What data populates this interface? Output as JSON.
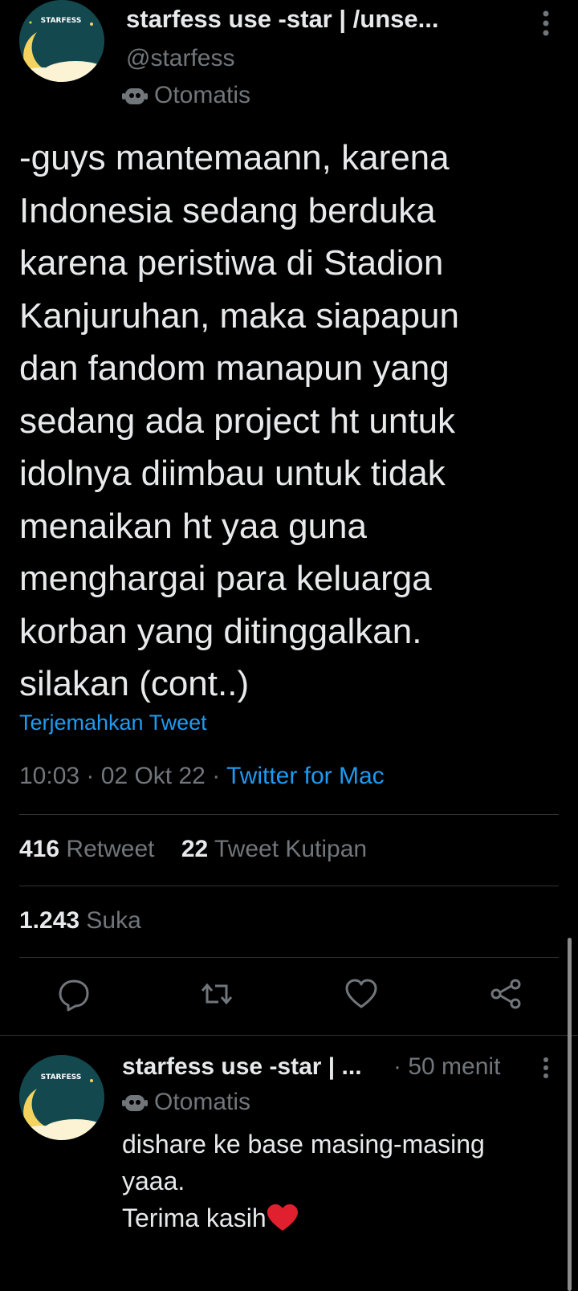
{
  "tweet": {
    "author_name": "starfess use -star | /unse...",
    "author_handle": "@starfess",
    "automated_label": "Otomatis",
    "avatar_text": "STARFESS",
    "body": "-guys mantemaann, karena\nIndonesia sedang berduka\nkarena peristiwa di Stadion\nKanjuruhan, maka siapapun\ndan fandom manapun yang\nsedang ada project ht untuk\nidolnya diimbau untuk tidak\nmenaikan ht yaa guna\nmenghargai para keluarga\nkorban yang ditinggalkan.\nsilakan  (cont..)",
    "translate_label": "Terjemahkan Tweet",
    "time": "10:03",
    "date": "02 Okt 22",
    "source": "Twitter for Mac",
    "separator": "·",
    "retweet_count": "416",
    "retweet_label": "Retweet",
    "quote_count": "22",
    "quote_label": "Tweet Kutipan",
    "like_count": "1.243",
    "like_label": "Suka"
  },
  "actions": [
    {
      "icon": "reply-icon"
    },
    {
      "icon": "retweet-icon"
    },
    {
      "icon": "like-icon"
    },
    {
      "icon": "share-icon"
    }
  ],
  "reply": {
    "author_name": "starfess use -star | ...",
    "separator": "·",
    "time": "50 menit",
    "automated_label": "Otomatis",
    "body": "dishare ke base masing-masing\nyaaa.\nTerima kasih",
    "avatar_text": "STARFESS"
  },
  "colors": {
    "background": "#000000",
    "link": "#1d9bf0",
    "muted": "#71767b",
    "heart": "#f91880"
  }
}
